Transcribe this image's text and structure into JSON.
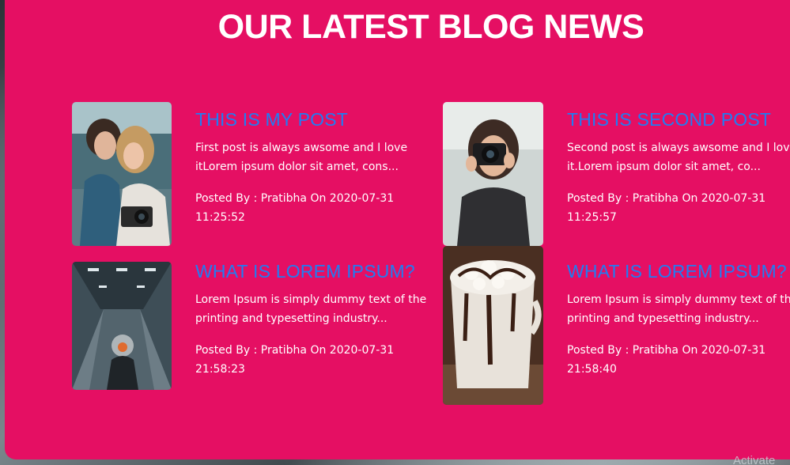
{
  "section": {
    "title": "OUR LATEST BLOG NEWS"
  },
  "posts": [
    {
      "title": "THIS IS MY POST",
      "excerpt_line1": "First post is always awsome and I love",
      "excerpt_line2": "itLorem ipsum dolor sit amet, cons...",
      "meta_line1": "Posted By : Pratibha On 2020-07-31",
      "meta_line2": "11:25:52",
      "image": "two-women-with-camera-photo"
    },
    {
      "title": "THIS IS SECOND POST",
      "excerpt_line1": "Second post is always awsome and I love",
      "excerpt_line2": "it.Lorem ipsum dolor sit amet, co...",
      "meta_line1": "Posted By : Pratibha On 2020-07-31",
      "meta_line2": "11:25:57",
      "image": "woman-with-camera-photo"
    },
    {
      "title": "WHAT IS LOREM IPSUM?",
      "excerpt_line1": "Lorem Ipsum is simply dummy text of the",
      "excerpt_line2": "printing and typesetting industry...",
      "meta_line1": "Posted By : Pratibha On 2020-07-31",
      "meta_line2": "21:58:23",
      "image": "subway-escalator-photo"
    },
    {
      "title": "WHAT IS LOREM IPSUM?",
      "excerpt_line1": "Lorem Ipsum is simply dummy text of the",
      "excerpt_line2": "printing and typesetting industry...",
      "meta_line1": "Posted By : Pratibha On 2020-07-31",
      "meta_line2": "21:58:40",
      "image": "hot-chocolate-marshmallow-photo"
    }
  ],
  "watermark": {
    "text": "Activate"
  },
  "colors": {
    "panel": "#e50f63",
    "post_title": "#1f7df3",
    "text": "#ffffff"
  }
}
